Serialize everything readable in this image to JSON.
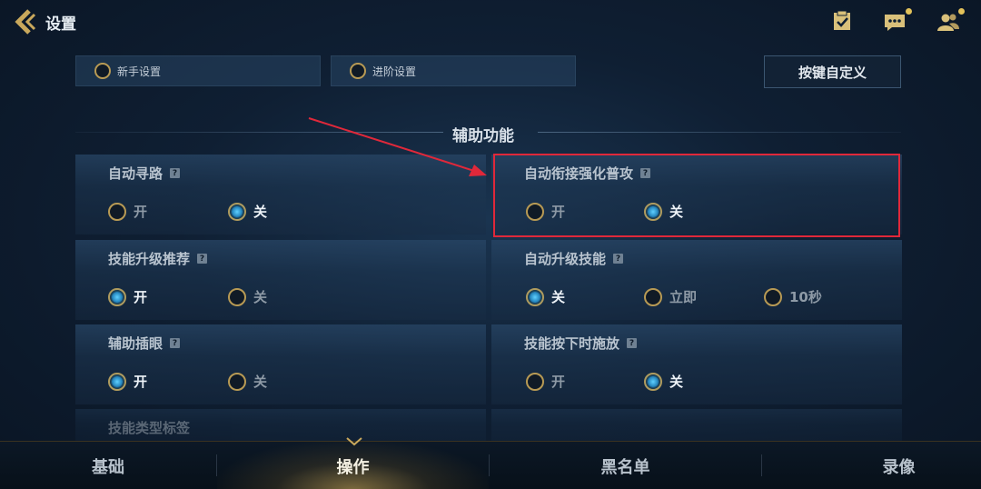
{
  "header": {
    "title": "设置",
    "icons": [
      "back-arrow-icon",
      "task-checklist-icon",
      "chat-bubble-icon",
      "friends-icon"
    ]
  },
  "mode_tabs": [
    {
      "label": "新手设置",
      "selected": false
    },
    {
      "label": "进阶设置",
      "selected": false
    }
  ],
  "custom_button": "按键自定义",
  "section_title": "辅助功能",
  "help_mark": "?",
  "settings": [
    {
      "title": "自动寻路",
      "options": [
        {
          "label": "开",
          "selected": false
        },
        {
          "label": "关",
          "selected": true
        }
      ]
    },
    {
      "title": "自动衔接强化普攻",
      "options": [
        {
          "label": "开",
          "selected": false
        },
        {
          "label": "关",
          "selected": true
        }
      ]
    },
    {
      "title": "技能升级推荐",
      "options": [
        {
          "label": "开",
          "selected": true
        },
        {
          "label": "关",
          "selected": false
        }
      ]
    },
    {
      "title": "自动升级技能",
      "options": [
        {
          "label": "关",
          "selected": true
        },
        {
          "label": "立即",
          "selected": false
        },
        {
          "label": "10秒",
          "selected": false
        }
      ]
    },
    {
      "title": "辅助插眼",
      "options": [
        {
          "label": "开",
          "selected": true
        },
        {
          "label": "关",
          "selected": false
        }
      ]
    },
    {
      "title": "技能按下时施放",
      "options": [
        {
          "label": "开",
          "selected": false
        },
        {
          "label": "关",
          "selected": true
        }
      ]
    },
    {
      "title": "技能类型标签"
    }
  ],
  "bottom_nav": [
    {
      "label": "基础",
      "active": false
    },
    {
      "label": "操作",
      "active": true
    },
    {
      "label": "黑名单",
      "active": false
    },
    {
      "label": "录像",
      "active": false
    }
  ],
  "colors": {
    "accent_gold": "#b89a54",
    "selected_blue": "#3fb6f0",
    "highlight_red": "#e0283a",
    "notification_dot": "#e2c15a"
  }
}
